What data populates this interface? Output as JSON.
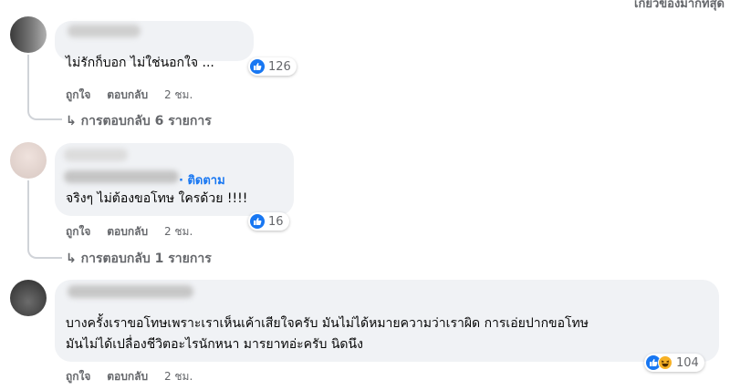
{
  "header": {
    "sort_label": "เกี่ยวข้องมากที่สุด"
  },
  "colors": {
    "like_blue": "#1877f2",
    "bubble_bg": "#f0f2f5",
    "meta_gray": "#65676b"
  },
  "comments": [
    {
      "text": "ไม่รักก็บอก ไม่ใช่นอกใจ ...",
      "reactions": {
        "icons": [
          "like-icon"
        ],
        "count": "126"
      },
      "actions": {
        "like": "ถูกใจ",
        "reply": "ตอบกลับ",
        "time": "2 ชม."
      },
      "replies_label": "การตอบกลับ 6 รายการ"
    },
    {
      "follow_label": "· ติดตาม",
      "text": "จริงๆ ไม่ต้องขอโทษ ใครด้วย !!!!",
      "reactions": {
        "icons": [
          "like-icon"
        ],
        "count": "16"
      },
      "actions": {
        "like": "ถูกใจ",
        "reply": "ตอบกลับ",
        "time": "2 ชม."
      },
      "replies_label": "การตอบกลับ 1 รายการ"
    },
    {
      "text_line1": "บางครั้งเราขอโทษเพราะเราเห็นเค้าเสียใจครับ มันไม่ได้หมายความว่าเราผิด การเอ่ยปากขอโทษ",
      "text_line2": "มันไม่ได้เปลื่องชีวิตอะไรนักหนา มารยาทอ่ะครับ นิดนึง",
      "reactions": {
        "icons": [
          "like-icon",
          "haha-icon"
        ],
        "count": "104"
      },
      "actions": {
        "like": "ถูกใจ",
        "reply": "ตอบกลับ",
        "time": "2 ชม."
      }
    }
  ]
}
